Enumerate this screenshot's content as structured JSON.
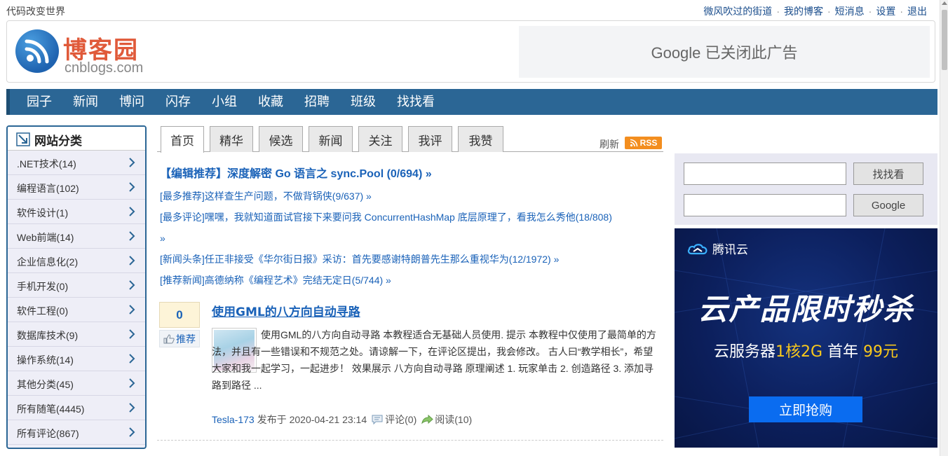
{
  "topbar": {
    "slogan": "代码改变世界",
    "links": [
      "微风吹过的街道",
      "我的博客",
      "短消息",
      "设置",
      "退出"
    ]
  },
  "header": {
    "logo_cn": "博客园",
    "logo_en": "cnblogs.com",
    "ad_text": "Google 已关闭此广告"
  },
  "nav": {
    "items": [
      "园子",
      "新闻",
      "博问",
      "闪存",
      "小组",
      "收藏",
      "招聘",
      "班级",
      "找找看"
    ]
  },
  "sidebar": {
    "title": "网站分类",
    "items": [
      {
        "label": ".NET技术(14)"
      },
      {
        "label": "编程语言(102)"
      },
      {
        "label": "软件设计(1)"
      },
      {
        "label": "Web前端(14)"
      },
      {
        "label": "企业信息化(2)"
      },
      {
        "label": "手机开发(0)"
      },
      {
        "label": "软件工程(0)"
      },
      {
        "label": "数据库技术(9)"
      },
      {
        "label": "操作系统(14)"
      },
      {
        "label": "其他分类(45)"
      },
      {
        "label": "所有随笔(4445)"
      },
      {
        "label": "所有评论(867)"
      }
    ]
  },
  "tabs": [
    "首页",
    "精华",
    "候选",
    "新闻",
    "关注",
    "我评",
    "我赞"
  ],
  "toolbar": {
    "refresh_label": "刷新",
    "rss_label": "RSS"
  },
  "headlines": {
    "main": "【编辑推荐】深度解密 Go 语言之 sync.Pool (0/694) »",
    "items": [
      "[最多推荐]这样查生产问题，不做背锅侠(9/637) »",
      "[最多评论]嘿嘿，我就知道面试官接下来要问我 ConcurrentHashMap 底层原理了，看我怎么秀他(18/808)",
      "»",
      "[新闻头条]任正非接受《华尔街日报》采访：首先要感谢特朗普先生那么重视华为(12/1972) »",
      "[推荐新闻]高德纳称《编程艺术》完结无定日(5/744) »"
    ]
  },
  "post": {
    "digg_count": "0",
    "digg_label": "推荐",
    "title": "使用GML的八方向自动寻路",
    "summary": "使用GML的八方向自动寻路 本教程适合无基础人员使用. 提示 本教程中仅使用了最简单的方法，并且有一些错误和不规范之处。请谅解一下，在评论区提出，我会修改。 古人曰“教学相长”，希望大家和我一起学习，一起进步！ 效果展示 八方向自动寻路 原理阐述 1. 玩家单击 2. 创造路径 3. 添加寻路到路径 ...",
    "author": "Tesla-173",
    "published": "发布于 2020-04-21 23:14",
    "comments": "评论(0)",
    "reads": "阅读(10)"
  },
  "search": {
    "button1": "找找看",
    "button2": "Google"
  },
  "ad": {
    "brand": "腾讯云",
    "headline": "云产品限时秒杀",
    "sub_prefix": "云服务器",
    "sub_hl1": "1核2G",
    "sub_mid": " 首年",
    "sub_hl2": "99元",
    "button": "立即抢购"
  },
  "colors": {
    "nav_bg": "#2b6695",
    "link": "#1a62b8",
    "rss": "#f38e1f",
    "ad_bg": "#0c1f5c",
    "ad_highlight": "#f8c81c"
  }
}
